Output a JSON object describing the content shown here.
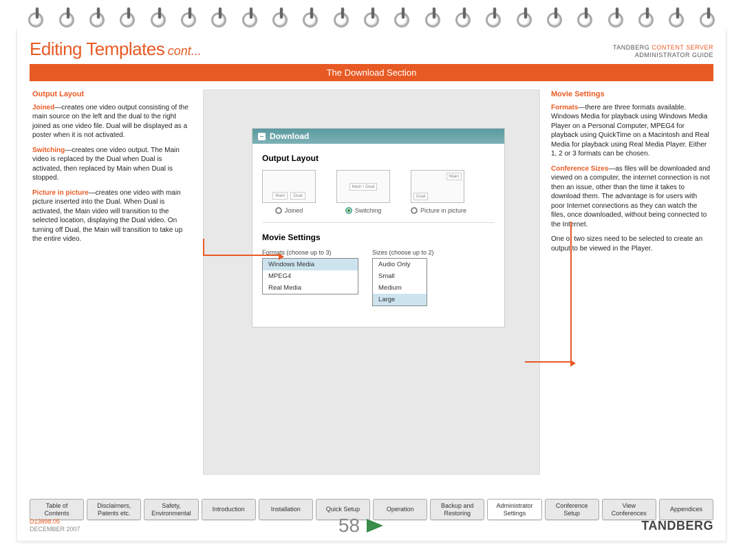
{
  "header": {
    "title_main": "Editing Templates",
    "title_cont": "cont...",
    "brand_line1a": "TANDBERG ",
    "brand_line1b": "CONTENT SERVER",
    "brand_line2": "ADMINISTRATOR GUIDE"
  },
  "orange_bar": "The Download Section",
  "left_col": {
    "heading": "Output Layout",
    "p1_term": "Joined",
    "p1": "—creates one video output consisting of the main source on the left and the dual to the right joined as one video file. Dual will be displayed as a poster when it is not activated.",
    "p2_term": "Switching",
    "p2": "—creates one video output. The Main video is replaced by the Dual when Dual is activated, then replaced by Main when Dual is stopped.",
    "p3_term": "Picture in picture",
    "p3": "—creates one video with main picture inserted into the Dual. When Dual is activated, the Main video will transition to the selected location, displaying the Dual video. On turning off Dual, the Main will transition to take up the entire video."
  },
  "right_col": {
    "heading": "Movie Settings",
    "p1_term": "Formats",
    "p1": "—there are three formats available. Windows Media for playback using Windows Media Player on a Personal Computer, MPEG4 for playback using QuickTime on a Macintosh and Real Media for playback using Real Media Player. Either 1, 2 or 3 formats can be chosen.",
    "p2_term": "Conference Sizes",
    "p2": "—as files will be downloaded and viewed on a computer, the internet connection is not then an issue, other than the time it takes to download them. The advantage is for users with poor Internet connections as they can watch the files, once downloaded, without being connected to the Internet.",
    "p3": "One or two sizes need to be selected to create an output to be viewed in the Player."
  },
  "panel": {
    "title": "Download",
    "section1": "Output Layout",
    "box1_a": "Main",
    "box1_b": "Dual",
    "box2": "Main / Dual",
    "box3_a": "Main",
    "box3_b": "Dual",
    "radio1": "Joined",
    "radio2": "Switching",
    "radio3": "Picture in picture",
    "section2": "Movie Settings",
    "formats_label": "Formats (choose up to 3)",
    "sizes_label": "Sizes (choose up to 2)",
    "formats": [
      "Windows Media",
      "MPEG4",
      "Real Media"
    ],
    "sizes": [
      "Audio Only",
      "Small",
      "Medium",
      "Large"
    ]
  },
  "tabs": [
    "Table of\nContents",
    "Disclaimers,\nPatents etc.",
    "Safety,\nEnvironmental",
    "Introduction",
    "Installation",
    "Quick Setup",
    "Operation",
    "Backup and\nRestoring",
    "Administrator\nSettings",
    "Conference\nSetup",
    "View\nConferences",
    "Appendices"
  ],
  "tabs_active_index": 8,
  "footer": {
    "doc_id": "D13898.05",
    "date": "DECEMBER 2007",
    "page_num": "58",
    "logo": "TANDBERG"
  }
}
